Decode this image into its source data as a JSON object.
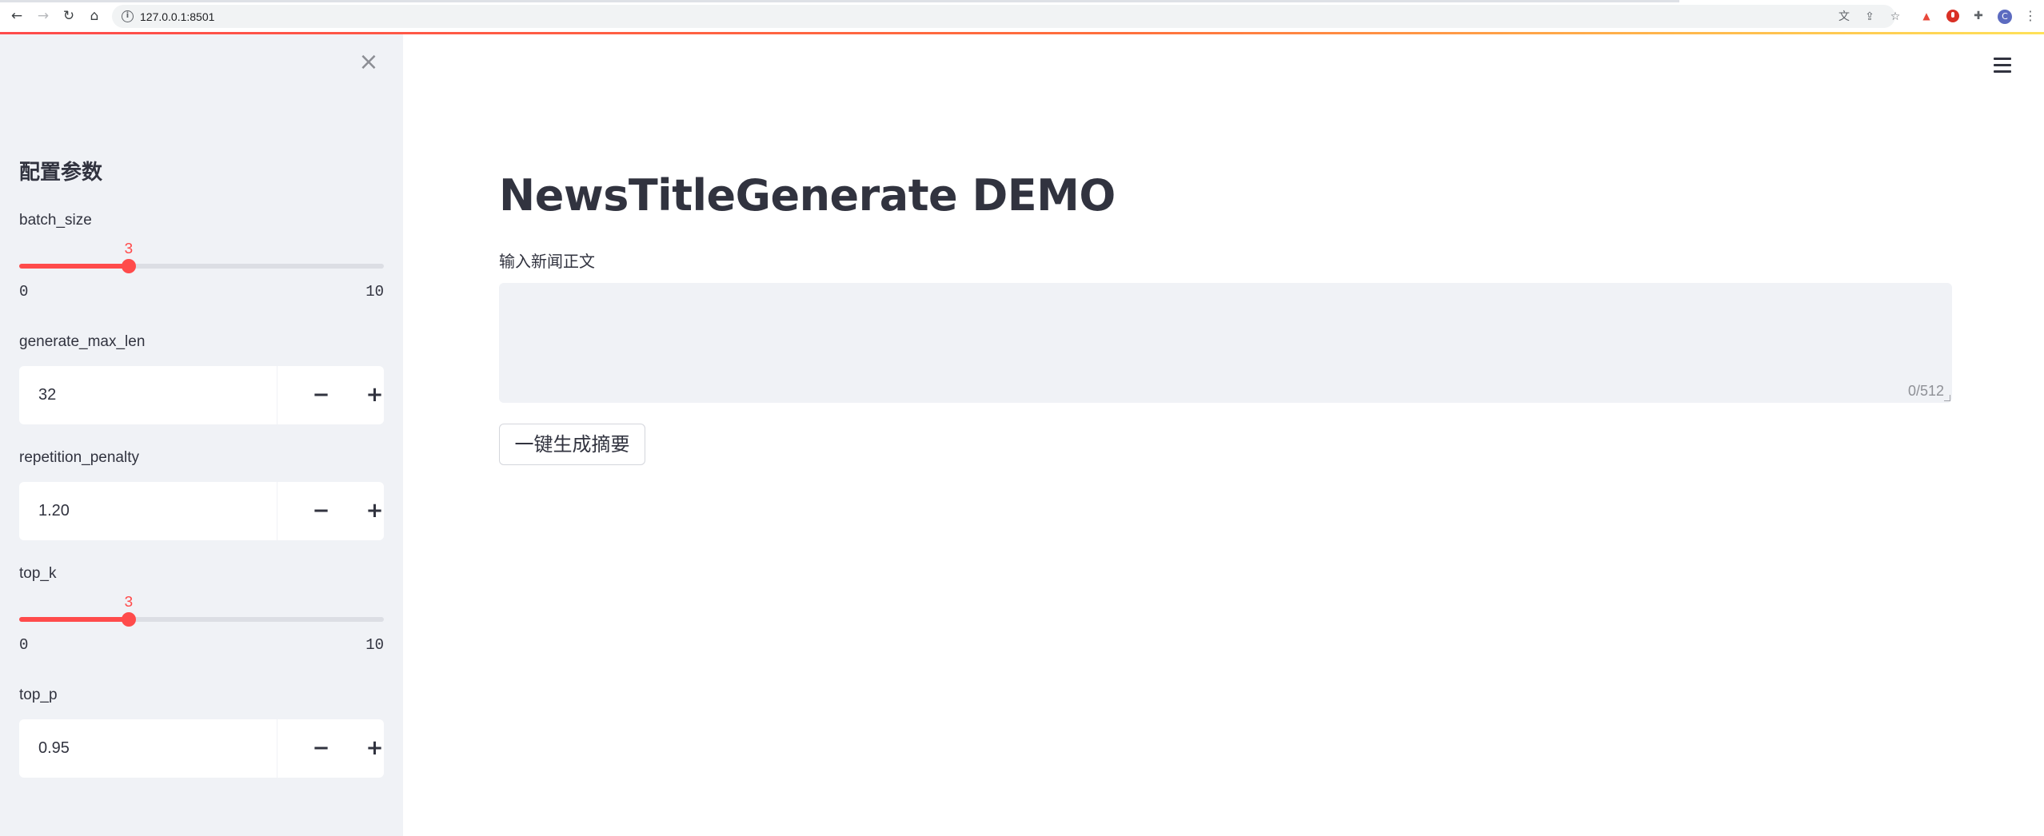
{
  "browser": {
    "url": "127.0.0.1:8501",
    "back_icon": "arrow-left-icon",
    "forward_icon": "arrow-right-icon",
    "reload_icon": "reload-icon",
    "home_icon": "home-icon",
    "site_info_icon": "info-icon",
    "omnibox_icons": [
      "translate-icon",
      "share-icon",
      "bookmark-star-icon"
    ],
    "extension_icons": [
      "extension-red-icon",
      "extension-record-icon",
      "puzzle-icon",
      "profile-avatar-icon",
      "kebab-menu-icon"
    ],
    "profile_initial": "C",
    "accent": "#ff4b4b"
  },
  "sidebar": {
    "close_icon": "close-icon",
    "title": "配置参数",
    "batch_size": {
      "label": "batch_size",
      "value": 3,
      "value_text": "3",
      "min": 0,
      "min_text": "0",
      "max": 10,
      "max_text": "10"
    },
    "generate_max_len": {
      "label": "generate_max_len",
      "value": "32"
    },
    "repetition_penalty": {
      "label": "repetition_penalty",
      "value": "1.20"
    },
    "top_k": {
      "label": "top_k",
      "value": 3,
      "value_text": "3",
      "min": 0,
      "min_text": "0",
      "max": 10,
      "max_text": "10"
    },
    "top_p": {
      "label": "top_p",
      "value": "0.95"
    },
    "minus_symbol": "−",
    "plus_symbol": "+"
  },
  "main": {
    "menu_icon": "hamburger-menu-icon",
    "title": "NewsTitleGenerate DEMO",
    "textarea": {
      "label": "输入新闻正文",
      "value": "",
      "char_count": "0/512"
    },
    "generate_button": "一键生成摘要"
  }
}
